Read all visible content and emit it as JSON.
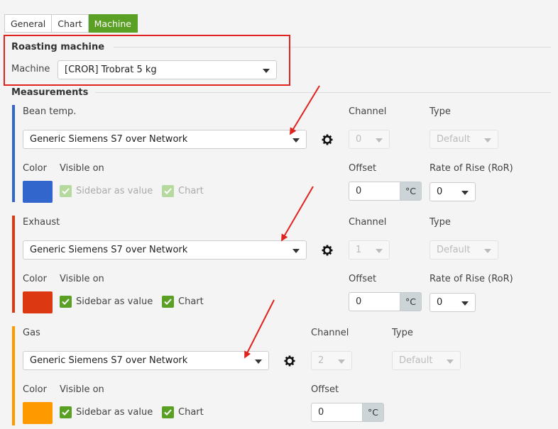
{
  "tabs": [
    {
      "label": "General",
      "active": false
    },
    {
      "label": "Chart",
      "active": false
    },
    {
      "label": "Machine",
      "active": true
    }
  ],
  "roasting": {
    "title": "Roasting machine",
    "machine_label": "Machine",
    "machine_value": "[CROR] Trobrat 5 kg"
  },
  "measurements": {
    "title": "Measurements",
    "items": [
      {
        "name": "Bean temp.",
        "device": "Generic Siemens S7 over Network",
        "channel_label": "Channel",
        "channel_value": "0",
        "type_label": "Type",
        "type_value": "Default",
        "color_label": "Color",
        "color": "#3366cc",
        "visible_label": "Visible on",
        "sidebar_label": "Sidebar as value",
        "sidebar_checked": true,
        "chart_label": "Chart",
        "chart_checked": true,
        "offset_label": "Offset",
        "offset_value": "0",
        "unit": "°C",
        "ror_label": "Rate of Rise (RoR)",
        "ror_value": "0"
      },
      {
        "name": "Exhaust",
        "device": "Generic Siemens S7 over Network",
        "channel_label": "Channel",
        "channel_value": "1",
        "type_label": "Type",
        "type_value": "Default",
        "color_label": "Color",
        "color": "#dc3912",
        "visible_label": "Visible on",
        "sidebar_label": "Sidebar as value",
        "sidebar_checked": true,
        "chart_label": "Chart",
        "chart_checked": true,
        "offset_label": "Offset",
        "offset_value": "0",
        "unit": "°C",
        "ror_label": "Rate of Rise (RoR)",
        "ror_value": "0"
      },
      {
        "name": "Gas",
        "device": "Generic Siemens S7 over Network",
        "channel_label": "Channel",
        "channel_value": "2",
        "type_label": "Type",
        "type_value": "Default",
        "color_label": "Color",
        "color": "#ff9900",
        "visible_label": "Visible on",
        "sidebar_label": "Sidebar as value",
        "sidebar_checked": true,
        "chart_label": "Chart",
        "chart_checked": true,
        "offset_label": "Offset",
        "offset_value": "0",
        "unit": "°C"
      }
    ]
  },
  "colors": {
    "accent": "#5aa025",
    "annotation": "#e1231f"
  }
}
